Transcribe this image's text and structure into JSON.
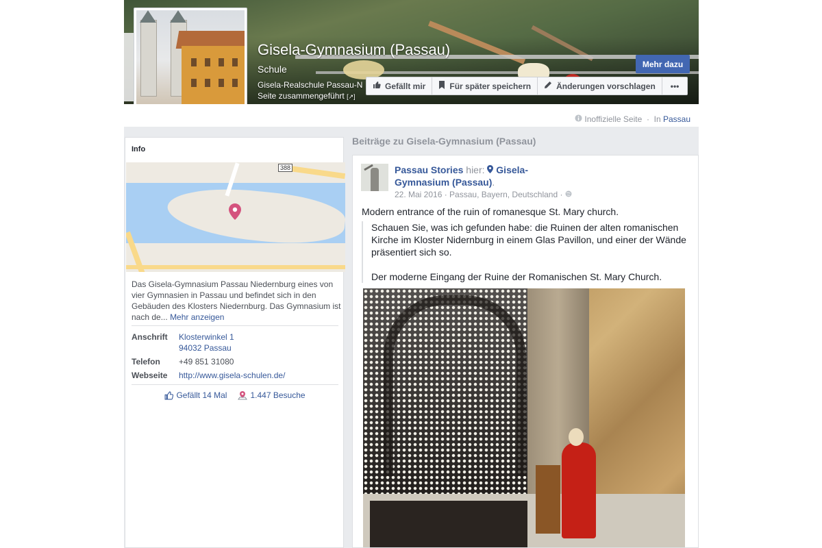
{
  "page": {
    "title": "Gisela-Gymnasium (Passau)",
    "category": "Schule",
    "merged_notice_line1": "Gisela-Realschule Passau-N",
    "merged_notice_line2": "Seite zusammengeführt",
    "merged_notice_ext": "[↗]",
    "cta_label": "Mehr dazu",
    "actions": {
      "like": "Gefällt mir",
      "save": "Für später speichern",
      "suggest": "Änderungen vorschlagen",
      "more": "•••"
    },
    "meta_unofficial": "Inoffizielle Seite",
    "meta_sep": "·",
    "meta_in": "In",
    "meta_location": "Passau"
  },
  "info": {
    "heading": "Info",
    "map_shield": "388",
    "description": "Das Gisela-Gymnasium Passau Niedernburg eines von vier Gymnasien in Passau und befindet sich in den Gebäuden des Klosters Niedernburg. Das Gymnasium ist nach de...",
    "show_more": "Mehr anzeigen",
    "address_label": "Anschrift",
    "address_line1": "Klosterwinkel 1",
    "address_line2": "94032 Passau",
    "phone_label": "Telefon",
    "phone": "+49 851 31080",
    "website_label": "Webseite",
    "website": "http://www.gisela-schulen.de/",
    "likes": "Gefällt 14 Mal",
    "visits": "1.447 Besuche"
  },
  "posts": {
    "heading": "Beiträge zu Gisela-Gymnasium (Passau)",
    "author": "Passau Stories",
    "author_suffix": "hier:",
    "location": "Gisela-Gymnasium (Passau)",
    "location_end": ".",
    "date": "22. Mai 2016 · Passau, Bayern, Deutschland ·",
    "text": "Modern entrance of the ruin of romanesque St. Mary church.",
    "quote_p1": "Schauen Sie, was ich gefunden habe: die Ruinen der alten romanischen Kirche im Kloster Nidernburg in einem Glas Pavillon, und einer der Wände präsentiert sich so.",
    "quote_p2": "Der moderne Eingang der Ruine der Romanischen St. Mary Church."
  },
  "colors": {
    "accent": "#4267b2",
    "link": "#365899",
    "pin": "#d4537e"
  }
}
